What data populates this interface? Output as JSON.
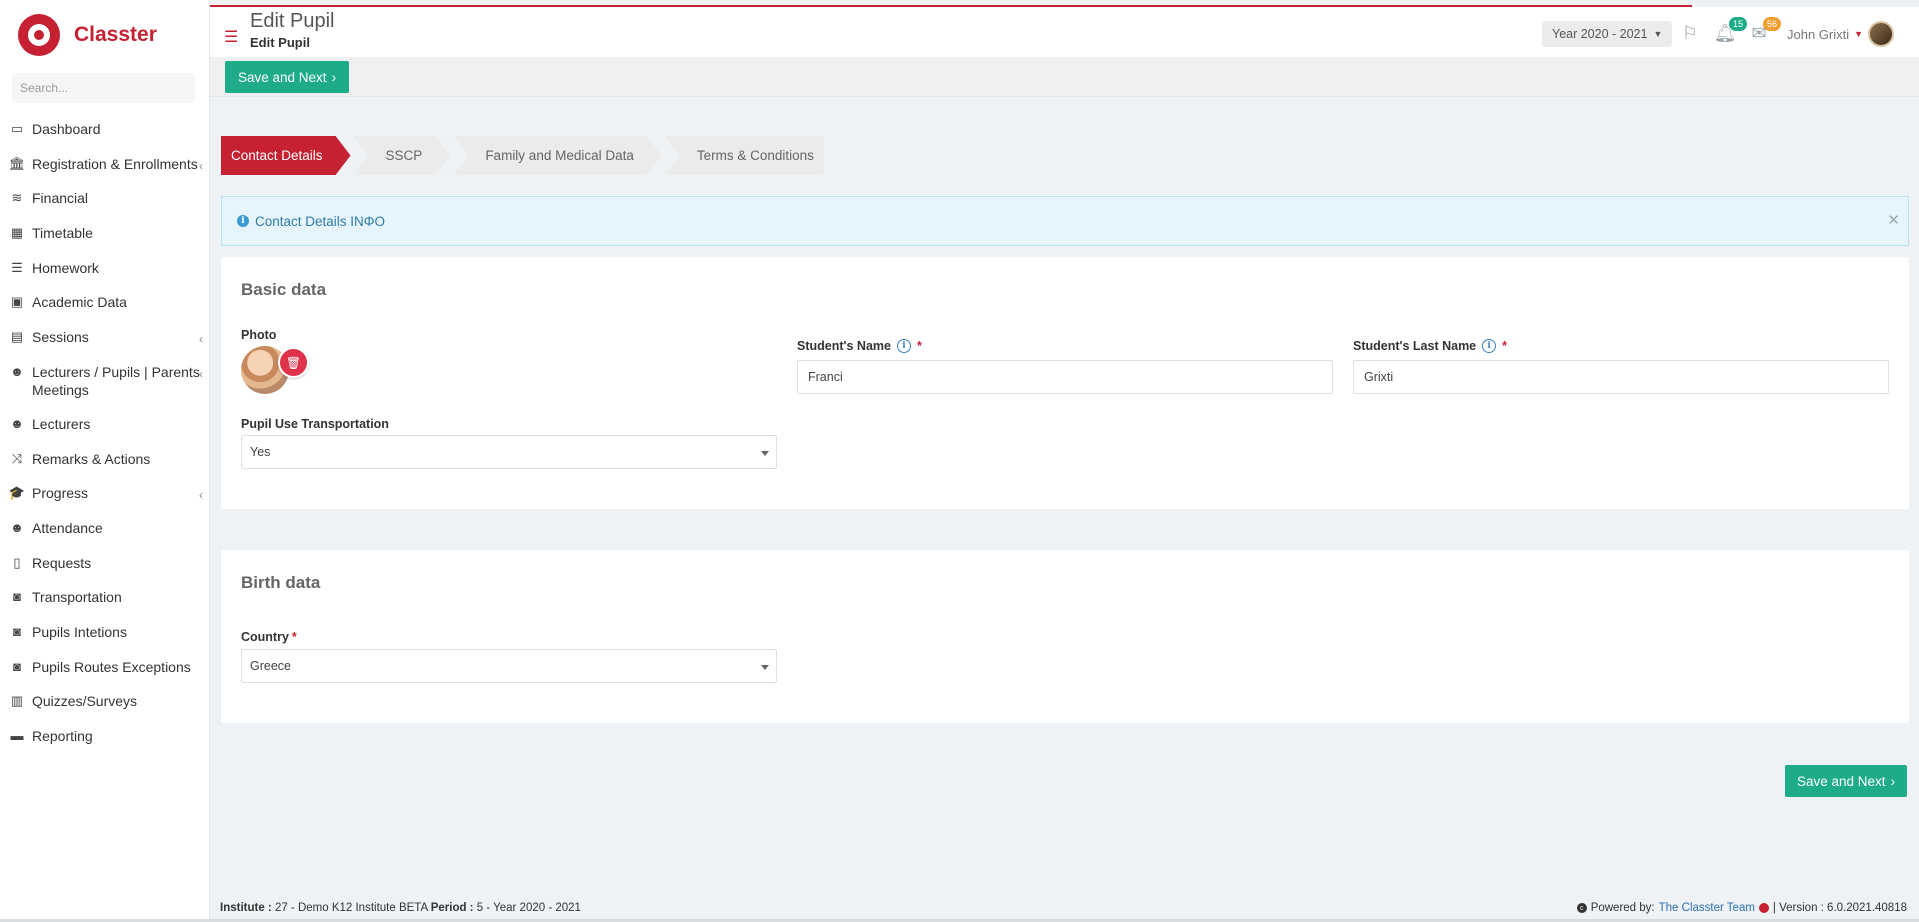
{
  "app": {
    "name": "Classter"
  },
  "search": {
    "placeholder": "Search..."
  },
  "sidebar": {
    "items": [
      {
        "label": "Dashboard",
        "icon": "laptop-icon",
        "glyph": "▭",
        "caret": false
      },
      {
        "label": "Registration & Enrollments",
        "icon": "institution-icon",
        "glyph": "🏛",
        "caret": true
      },
      {
        "label": "Financial",
        "icon": "coins-icon",
        "glyph": "≋",
        "caret": false
      },
      {
        "label": "Timetable",
        "icon": "calendar-icon",
        "glyph": "▦",
        "caret": false
      },
      {
        "label": "Homework",
        "icon": "list-icon",
        "glyph": "☰",
        "caret": false
      },
      {
        "label": "Academic Data",
        "icon": "id-card-icon",
        "glyph": "▣",
        "caret": false
      },
      {
        "label": "Sessions",
        "icon": "chalkboard-icon",
        "glyph": "▤",
        "caret": true
      },
      {
        "label": "Lecturers / Pupils | Parents Meetings",
        "icon": "user-clock-icon",
        "glyph": "☻",
        "caret": true,
        "multi": true
      },
      {
        "label": "Lecturers",
        "icon": "users-icon",
        "glyph": "☻",
        "caret": false
      },
      {
        "label": "Remarks & Actions",
        "icon": "shuffle-icon",
        "glyph": "⤨",
        "caret": false
      },
      {
        "label": "Progress",
        "icon": "graduation-cap-icon",
        "glyph": "🎓",
        "caret": true
      },
      {
        "label": "Attendance",
        "icon": "user-times-icon",
        "glyph": "☻",
        "caret": false
      },
      {
        "label": "Requests",
        "icon": "file-icon",
        "glyph": "▯",
        "caret": false
      },
      {
        "label": "Transportation",
        "icon": "bus-icon",
        "glyph": "◙",
        "caret": false
      },
      {
        "label": "Pupils Intetions",
        "icon": "bus-icon",
        "glyph": "◙",
        "caret": false
      },
      {
        "label": "Pupils Routes Exceptions",
        "icon": "bus-icon",
        "glyph": "◙",
        "caret": false
      },
      {
        "label": "Quizzes/Surveys",
        "icon": "clipboard-icon",
        "glyph": "▥",
        "caret": false
      },
      {
        "label": "Reporting",
        "icon": "print-icon",
        "glyph": "▬",
        "caret": false
      }
    ]
  },
  "header": {
    "title": "Edit Pupil",
    "subtitle": "Edit Pupil",
    "year": "Year 2020 - 2021",
    "notifications_count": "15",
    "messages_count": "56",
    "user_name": "John Grixti",
    "notif_color": "#1eab8a",
    "msg_color": "#f0a030"
  },
  "toolbar": {
    "save_next_label": "Save and Next"
  },
  "wizard": {
    "steps": [
      {
        "label": "Contact Details",
        "active": true
      },
      {
        "label": "SSCP",
        "active": false
      },
      {
        "label": "Family and Medical Data",
        "active": false
      },
      {
        "label": "Terms & Conditions",
        "active": false
      }
    ]
  },
  "alert": {
    "text": "Contact Details INΦO"
  },
  "basic": {
    "title": "Basic data",
    "photo_label": "Photo",
    "first_name_label": "Student's Name",
    "first_name_value": "Franci",
    "last_name_label": "Student's Last Name",
    "last_name_value": "Grixti",
    "transport_label": "Pupil Use Transportation",
    "transport_value": "Yes"
  },
  "birth": {
    "title": "Birth data",
    "country_label": "Country",
    "country_value": "Greece"
  },
  "footer": {
    "institute_label": "Institute :",
    "institute_value": " 27 - Demo K12 Institute BETA ",
    "period_label": "Period :",
    "period_value": " 5 - Year 2020 - 2021",
    "powered_label": "Powered by:",
    "team": "The Classter Team",
    "version": "| Version : 6.0.2021.40818"
  },
  "colors": {
    "brand": "#c62132",
    "accent": "#1eab8a",
    "info": "#2e7ba8"
  }
}
